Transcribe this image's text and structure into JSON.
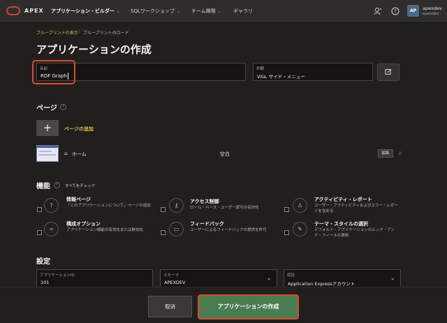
{
  "topbar": {
    "brand": "APEX",
    "nav": [
      {
        "label": "アプリケーション・ビルダー",
        "active": true
      },
      {
        "label": "SQLワークショップ",
        "active": false
      },
      {
        "label": "チーム開発",
        "active": false
      },
      {
        "label": "ギャラリ",
        "active": false
      }
    ],
    "user_initials": "AP",
    "user_name": "apexdev",
    "user_workspace": "apexdev"
  },
  "breadcrumb": {
    "item1": "ブループリントの表示",
    "separator": "|",
    "item2": "ブループリントのロード"
  },
  "page_title": "アプリケーションの作成",
  "name_field": {
    "label": "名前",
    "value": "RDF Graph"
  },
  "appearance_field": {
    "label": "外観",
    "value": "Vita, サイド・メニュー"
  },
  "pages": {
    "heading": "ページ",
    "add_label": "ページの追加",
    "rows": [
      {
        "name": "ホーム",
        "type": "空白",
        "edit_label": "編集"
      }
    ]
  },
  "features": {
    "heading": "機能",
    "check_all": "すべてをチェック",
    "items": [
      {
        "title": "情報ページ",
        "desc": "「このアプリケーションについて」ページの追加",
        "icon": "info-icon"
      },
      {
        "title": "アクセス制御",
        "desc": "ロール・ベース・ユーザー認可の有効化",
        "icon": "key-icon"
      },
      {
        "title": "アクティビティ・レポート",
        "desc": "ユーザー・アクティビティおよびエラー・レポートを含める",
        "icon": "user-report-icon"
      },
      {
        "title": "構成オプション",
        "desc": "アプリケーション機能の有効化または無効化",
        "icon": "sliders-icon"
      },
      {
        "title": "フィードバック",
        "desc": "ユーザーによるフィードバックの提供を許可",
        "icon": "chat-icon"
      },
      {
        "title": "テーマ・スタイルの選択",
        "desc": "デフォルト・アプリケーションのルック・アンド・フィールの更新",
        "icon": "brush-icon"
      }
    ]
  },
  "settings": {
    "heading": "設定",
    "app_id": {
      "label": "アプリケーションID",
      "value": "101"
    },
    "schema": {
      "label": "スキーマ",
      "value": "APEXDEV"
    },
    "auth": {
      "label": "認証",
      "value": "Application Expressアカウント"
    }
  },
  "buttons": {
    "cancel": "取消",
    "create": "アプリケーションの作成"
  },
  "colors": {
    "accent_link": "#e5b94a",
    "create_button": "#4a7c51",
    "highlight": "#e04a2a"
  }
}
